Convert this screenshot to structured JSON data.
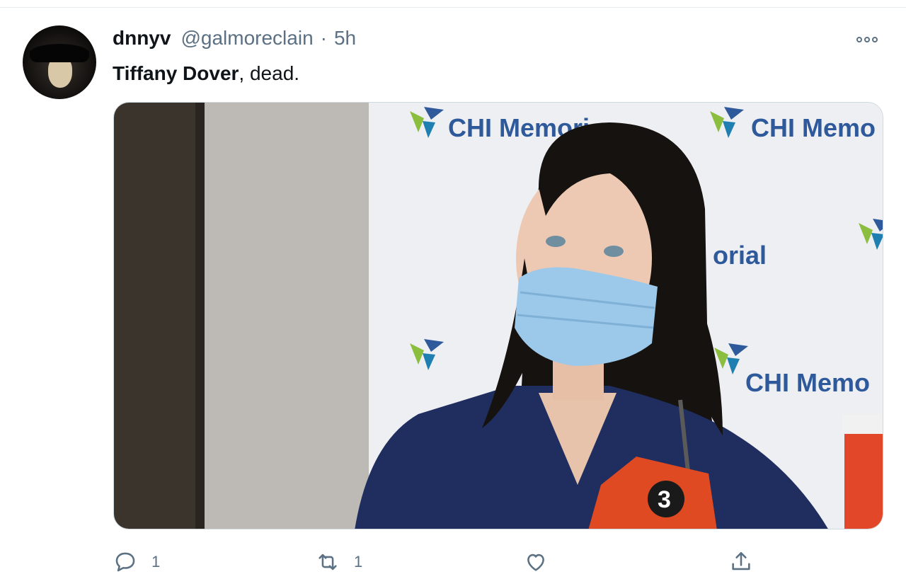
{
  "tweet": {
    "author_name": "dnnyv",
    "handle": "@galmoreclain",
    "separator": "·",
    "time": "5h",
    "text_bold": "Tiffany Dover",
    "text_rest": ", dead."
  },
  "media": {
    "backdrop_text": [
      "CHI Memori",
      "CHI Memo",
      "orial",
      "CHI Memo"
    ],
    "mic_flag_text": "3"
  },
  "actions": {
    "reply_count": "1",
    "retweet_count": "1"
  },
  "icons": {
    "more": "more-horizontal-icon",
    "reply": "reply-icon",
    "retweet": "retweet-icon",
    "like": "heart-icon",
    "share": "share-icon"
  },
  "colors": {
    "secondary_text": "#5b7083",
    "chi_blue": "#2e5a9c",
    "chi_green": "#8bbd3f",
    "scrubs": "#1f2e5e",
    "mask": "#9cc8ea"
  }
}
